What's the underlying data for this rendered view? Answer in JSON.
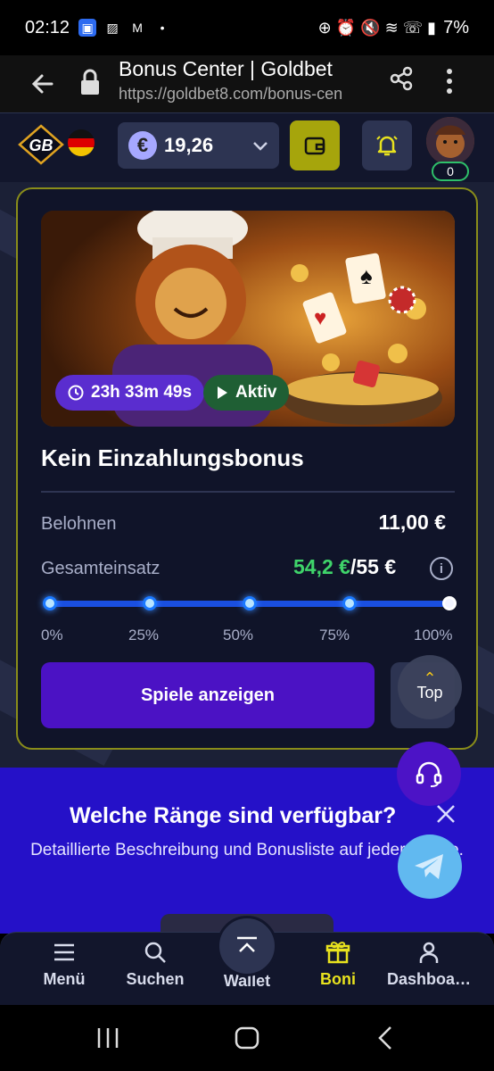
{
  "status_bar": {
    "time": "02:12",
    "battery": "7%"
  },
  "browser": {
    "page_title": "Bonus Center | Goldbet",
    "url": "https://goldbet8.com/bonus-cen"
  },
  "header": {
    "logo_text": "GB",
    "balance": "19,26",
    "currency_symbol": "€",
    "avatar_badge": "0"
  },
  "bonus_card": {
    "timer": "23h 33m 49s",
    "status": "Aktiv",
    "title": "Kein Einzahlungsbonus",
    "reward_label": "Belohnen",
    "reward_value": "11,00 €",
    "wager_label": "Gesamteinsatz",
    "wager_current": "54,2 €",
    "wager_total": "/55 €",
    "progress_fraction": 1.0,
    "progress_ticks": [
      "0%",
      "25%",
      "50%",
      "75%",
      "100%"
    ],
    "games_button": "Spiele anzeigen"
  },
  "top_button": "Top",
  "promo": {
    "title": "Welche Ränge sind verfügbar?",
    "description": "Detaillierte Beschreibung und Bonusliste auf jeder Ebene."
  },
  "bottom_nav": {
    "items": [
      {
        "label": "Menü",
        "icon": "menu-icon"
      },
      {
        "label": "Suchen",
        "icon": "search-icon"
      },
      {
        "label": "Wallet",
        "icon": "wallet-icon"
      },
      {
        "label": "Boni",
        "icon": "gift-icon"
      },
      {
        "label": "Dashboa…",
        "icon": "user-icon"
      }
    ],
    "active": "Boni"
  },
  "colors": {
    "accent_yellow": "#e8e21e",
    "primary_purple": "#4b12c4",
    "promo_blue": "#2511c8",
    "success_green": "#3fd46a"
  }
}
